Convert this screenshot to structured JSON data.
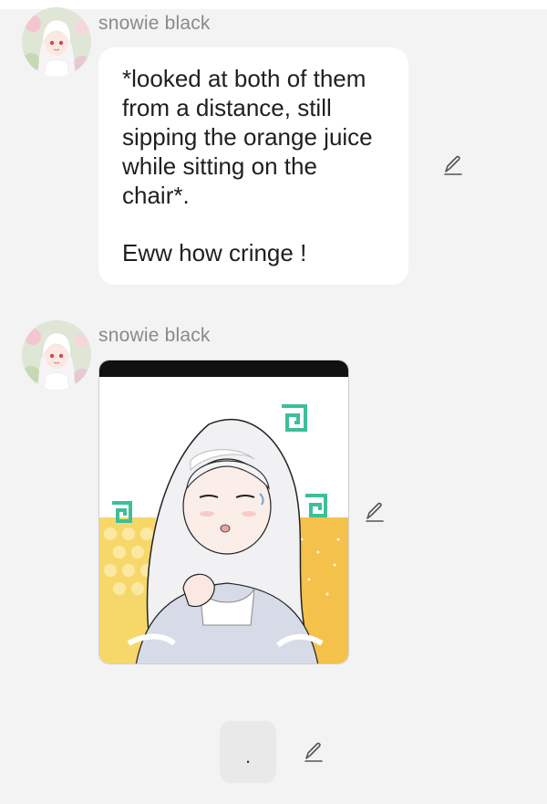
{
  "messages": [
    {
      "sender": "snowie black",
      "text_lines": [
        "*looked at both of them",
        "from a distance, still",
        "sipping the orange juice",
        "while sitting on the",
        "chair*."
      ],
      "text_after": "Eww how cringe !",
      "avatar_icon": "avatar-image",
      "edit_icon": "pencil-edit-icon"
    },
    {
      "sender": "snowie black",
      "type": "image",
      "image_icon": "anime-girl-image",
      "edit_icon": "pencil-edit-icon"
    },
    {
      "type": "text",
      "text": ".",
      "edit_icon": "pencil-edit-icon"
    }
  ],
  "colors": {
    "background": "#f3f3f3",
    "bubble": "#ffffff",
    "sender_name": "#8a8a8a",
    "text": "#1f1f1f",
    "pending_bubble": "#e9e9e9"
  }
}
